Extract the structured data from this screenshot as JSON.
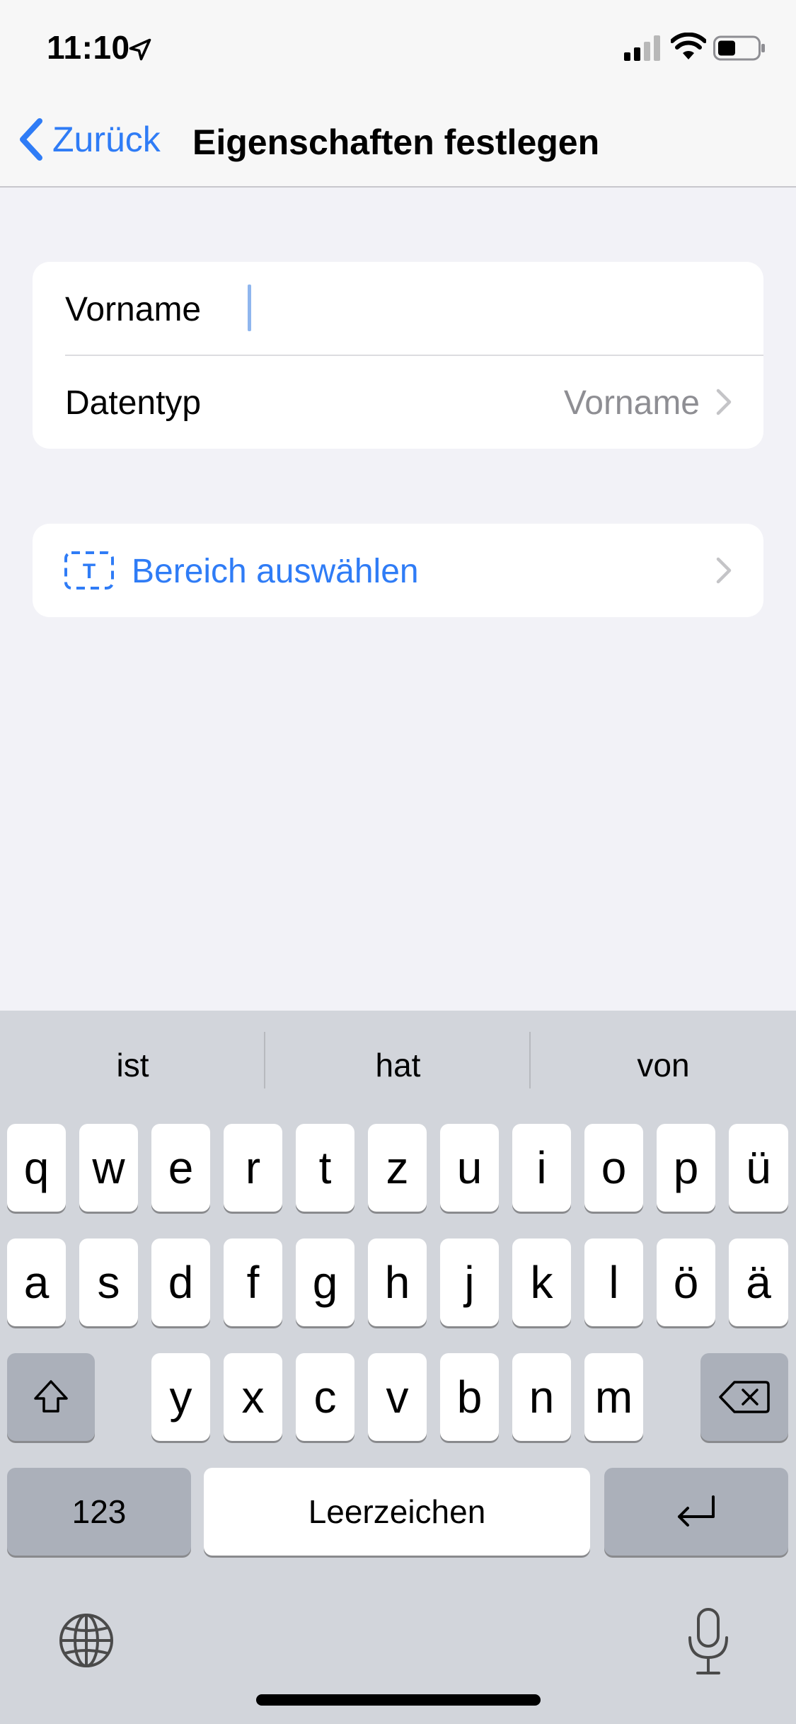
{
  "status_bar": {
    "time": "11:10"
  },
  "nav": {
    "back_label": "Zurück",
    "title": "Eigenschaften festlegen"
  },
  "properties": {
    "name_value": "Vorname",
    "type_label": "Datentyp",
    "type_value": "Vorname"
  },
  "area": {
    "label": "Bereich auswählen",
    "icon_letter": "T"
  },
  "keyboard": {
    "suggestions": [
      "ist",
      "hat",
      "von"
    ],
    "row1": [
      "q",
      "w",
      "e",
      "r",
      "t",
      "z",
      "u",
      "i",
      "o",
      "p",
      "ü"
    ],
    "row2": [
      "a",
      "s",
      "d",
      "f",
      "g",
      "h",
      "j",
      "k",
      "l",
      "ö",
      "ä"
    ],
    "row3": [
      "y",
      "x",
      "c",
      "v",
      "b",
      "n",
      "m"
    ],
    "numbers_label": "123",
    "space_label": "Leerzeichen"
  },
  "colors": {
    "accent": "#2f7cf6",
    "background": "#f2f2f7",
    "keyboard_bg": "#d2d5db"
  }
}
